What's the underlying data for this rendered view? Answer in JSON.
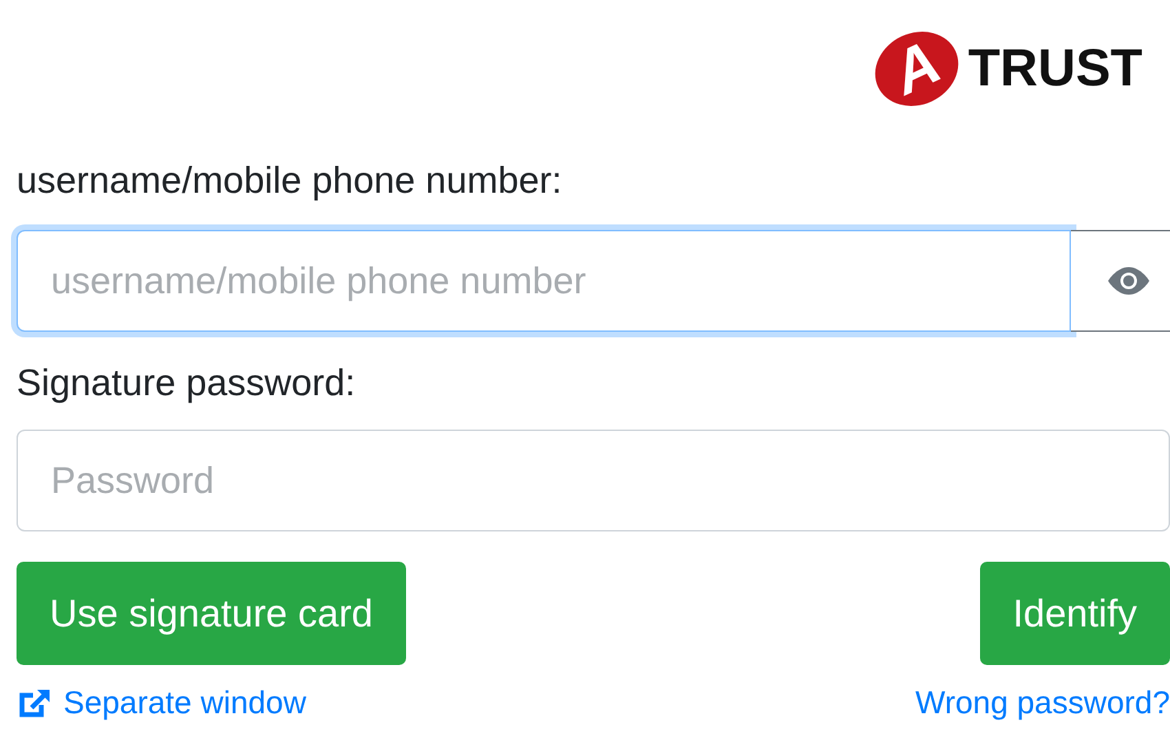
{
  "logo": {
    "mark": "A",
    "name": "TRUST"
  },
  "username": {
    "label": "username/mobile phone number:",
    "placeholder": "username/mobile phone number",
    "focused": true
  },
  "password": {
    "label": "Signature password:",
    "placeholder": "Password"
  },
  "buttons": [
    {
      "label": "Use signature card"
    },
    {
      "label": "Identify"
    }
  ],
  "links": [
    {
      "label": "Separate window",
      "kind": "external"
    },
    {
      "label": "Wrong password?",
      "kind": "plain"
    }
  ]
}
